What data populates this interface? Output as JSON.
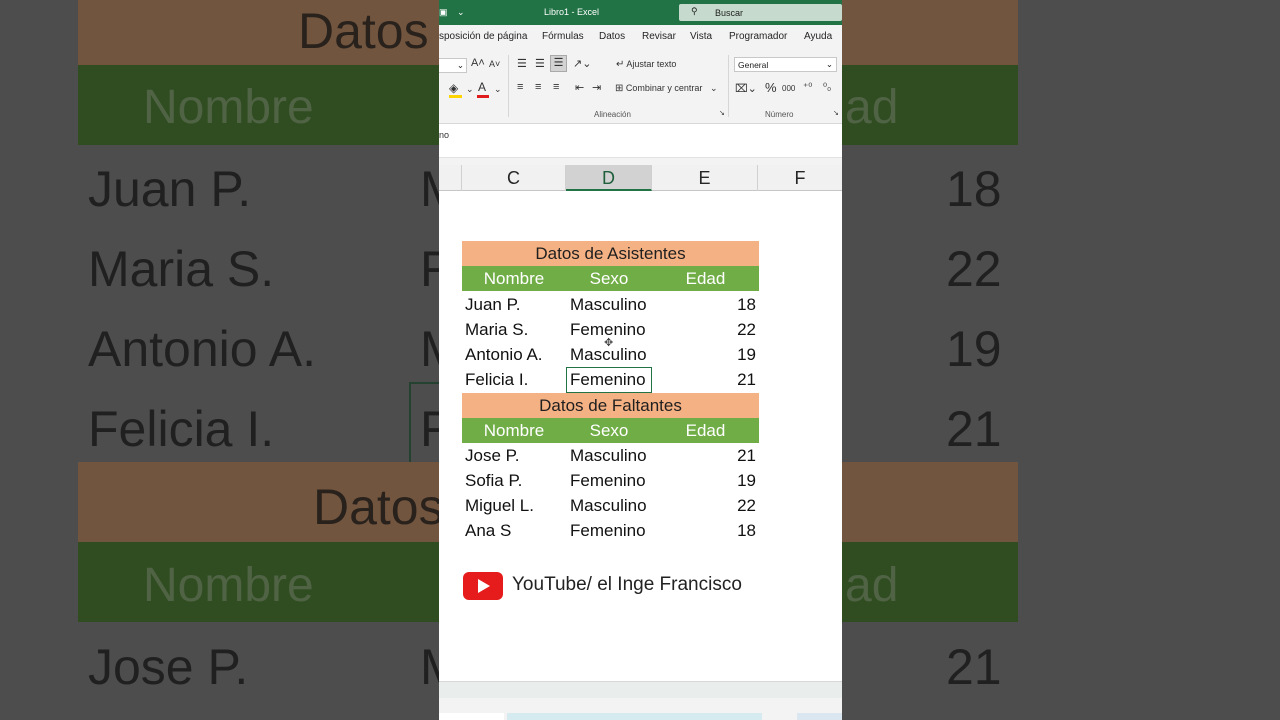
{
  "background_zoom": {
    "title_fragment": "Datos",
    "header_nombre": "Nombre",
    "header_edad_fragment": "ad",
    "names": [
      "Juan P.",
      "Maria S.",
      "Antonio A.",
      "Felicia I."
    ],
    "ages": [
      "18",
      "22",
      "19",
      "21"
    ],
    "initial_m": "M",
    "initial_f": "F",
    "lower_title_fragment": "Datos",
    "lower_nombre": "Nombre",
    "lower_edad_fragment": "ad",
    "lower_name": "Jose P.",
    "lower_initial": "M",
    "lower_age": "21"
  },
  "titlebar": {
    "title": "Libro1  -  Excel",
    "search_placeholder": "Buscar"
  },
  "menu": {
    "items": [
      "sposición de página",
      "Fórmulas",
      "Datos",
      "Revisar",
      "Vista",
      "Programador",
      "Ayuda"
    ]
  },
  "ribbon": {
    "wrap_text": "Ajustar texto",
    "merge_center": "Combinar y centrar",
    "number_format": "General",
    "alignment_group": "Alineación",
    "number_group": "Número",
    "percent": "%",
    "thousands": "000",
    "grow_font": "A",
    "shrink_font": "A"
  },
  "formula_bar": {
    "content_fragment": "no"
  },
  "columns": [
    "C",
    "D",
    "E",
    "F"
  ],
  "table": {
    "title_attendees": "Datos de Asistentes",
    "title_missing": "Datos de Faltantes",
    "headers": [
      "Nombre",
      "Sexo",
      "Edad"
    ],
    "attendees": [
      {
        "name": "Juan P.",
        "sex": "Masculino",
        "age": "18"
      },
      {
        "name": "Maria S.",
        "sex": "Femenino",
        "age": "22"
      },
      {
        "name": "Antonio A.",
        "sex": "Masculino",
        "age": "19"
      },
      {
        "name": "Felicia I.",
        "sex": "Femenino",
        "age": "21"
      }
    ],
    "missing": [
      {
        "name": "Jose P.",
        "sex": "Masculino",
        "age": "21"
      },
      {
        "name": "Sofia P.",
        "sex": "Femenino",
        "age": "19"
      },
      {
        "name": "Miguel L.",
        "sex": "Masculino",
        "age": "22"
      },
      {
        "name": "Ana S",
        "sex": "Femenino",
        "age": "18"
      }
    ]
  },
  "watermark": {
    "text": "YouTube/ el Inge Francisco",
    "icon": "youtube-icon"
  },
  "colors": {
    "excel_green": "#217346",
    "table_title_bg": "#f4b183",
    "table_header_bg": "#70ad47",
    "youtube_red": "#e61b1b"
  }
}
